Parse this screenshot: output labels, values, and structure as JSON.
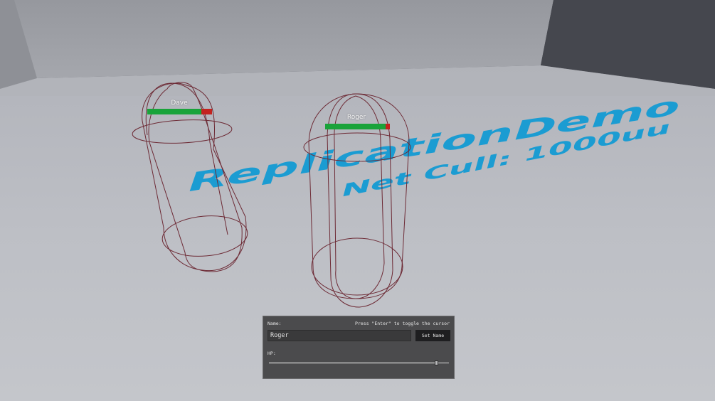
{
  "floor_text": {
    "title": "ReplicationDemo",
    "subtitle": "Net Cull: 1000uu"
  },
  "characters": [
    {
      "name": "Dave",
      "hp_fraction": 0.84
    },
    {
      "name": "Roger",
      "hp_fraction": 0.93
    }
  ],
  "panel": {
    "name_label": "Name:",
    "hint": "Press \"Enter\" to toggle the cursor",
    "name_value": "Roger",
    "set_name_button": "Set Name",
    "hp_label": "HP:",
    "hp_slider_fraction": 0.93
  },
  "colors": {
    "floor_text": "#1b9cd2",
    "hp_fill": "#19a33a",
    "hp_empty": "#c3231f",
    "wireframe": "#6d2a35"
  }
}
